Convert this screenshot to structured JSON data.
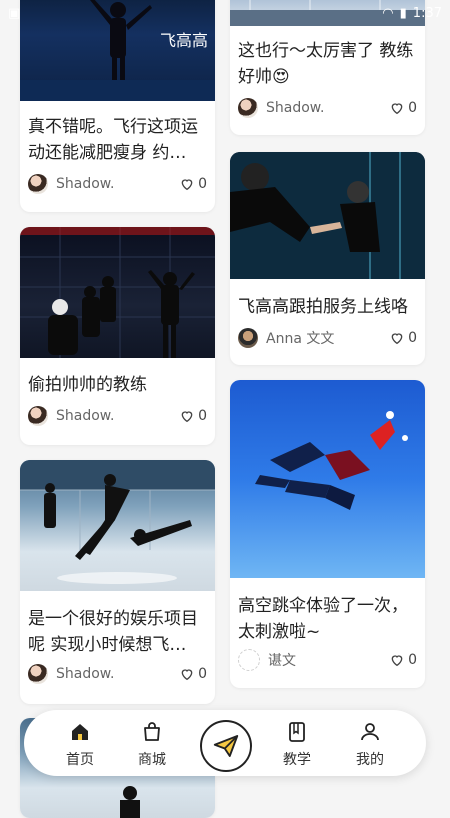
{
  "statusbar": {
    "time": "1:37"
  },
  "feed": {
    "left": [
      {
        "title": "真不错呢。飞行这项运动还能减肥瘦身 约…",
        "author": "Shadow.",
        "likes": "0",
        "caption": "飞高高"
      },
      {
        "title": "偷拍帅帅的教练",
        "author": "Shadow.",
        "likes": "0"
      },
      {
        "title": "是一个很好的娱乐项目呢 实现小时候想飞…",
        "author": "Shadow.",
        "likes": "0"
      }
    ],
    "right": [
      {
        "title": "这也行～太厉害了 教练好帅😍",
        "author": "Shadow.",
        "likes": "0"
      },
      {
        "title": "飞高高跟拍服务上线咯",
        "author": "Anna 文文",
        "likes": "0"
      },
      {
        "title": "高空跳伞体验了一次，太刺激啦~",
        "author": "谌文",
        "likes": "0"
      }
    ]
  },
  "nav": {
    "items": [
      {
        "label": "首页",
        "icon": "home-icon",
        "active": true
      },
      {
        "label": "商城",
        "icon": "bag-icon"
      },
      {
        "label": "",
        "icon": "paper-plane-icon"
      },
      {
        "label": "教学",
        "icon": "book-icon"
      },
      {
        "label": "我的",
        "icon": "user-icon"
      }
    ]
  },
  "colors": {
    "background": "#f5f5f5",
    "card": "#ffffff",
    "text": "#222222",
    "accent": "#f5c842"
  }
}
